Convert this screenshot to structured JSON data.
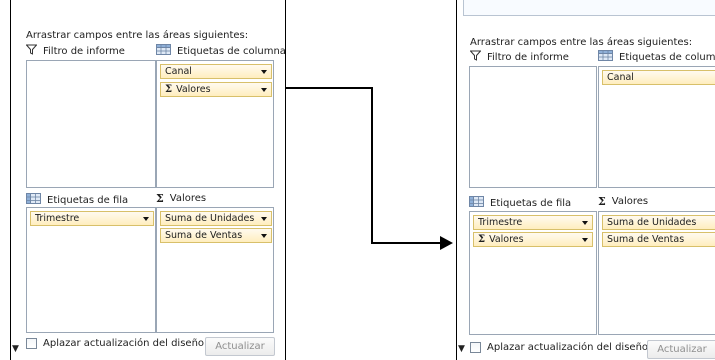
{
  "left_panel": {
    "drag_label": "Arrastrar campos entre las áreas siguientes:",
    "report_filter": {
      "title": "Filtro de informe",
      "icon": "funnel-icon",
      "fields": []
    },
    "column_labels": {
      "title": "Etiquetas de columna",
      "icon": "grid-icon",
      "fields": [
        {
          "label": "Canal",
          "sigma": ""
        },
        {
          "label": "Valores",
          "sigma": "Σ"
        }
      ]
    },
    "row_labels": {
      "title": "Etiquetas de fila",
      "icon": "grid-icon",
      "fields": [
        {
          "label": "Trimestre",
          "sigma": ""
        }
      ]
    },
    "values": {
      "title": "Valores",
      "icon": "sigma-icon",
      "fields": [
        {
          "label": "Suma de Unidades"
        },
        {
          "label": "Suma de Ventas"
        }
      ]
    },
    "defer_label": "Aplazar actualización del diseño",
    "update_button": "Actualizar"
  },
  "right_panel": {
    "drag_label": "Arrastrar campos entre las áreas siguientes:",
    "report_filter": {
      "title": "Filtro de informe",
      "icon": "funnel-icon",
      "fields": []
    },
    "column_labels": {
      "title": "Etiquetas de columna",
      "icon": "grid-icon",
      "fields": [
        {
          "label": "Canal",
          "sigma": ""
        }
      ]
    },
    "row_labels": {
      "title": "Etiquetas de fila",
      "icon": "grid-icon",
      "fields": [
        {
          "label": "Trimestre",
          "sigma": ""
        },
        {
          "label": "Valores",
          "sigma": "Σ"
        }
      ]
    },
    "values": {
      "title": "Valores",
      "icon": "sigma-icon",
      "fields": [
        {
          "label": "Suma de Unidades"
        },
        {
          "label": "Suma de Ventas"
        }
      ]
    },
    "defer_label": "Aplazar actualización del diseño",
    "update_button": "Actualizar"
  },
  "colors": {
    "field_bg": "#ffeebe",
    "field_border": "#d8c06a",
    "area_border": "#9aa6b5",
    "connector": "#000000"
  }
}
